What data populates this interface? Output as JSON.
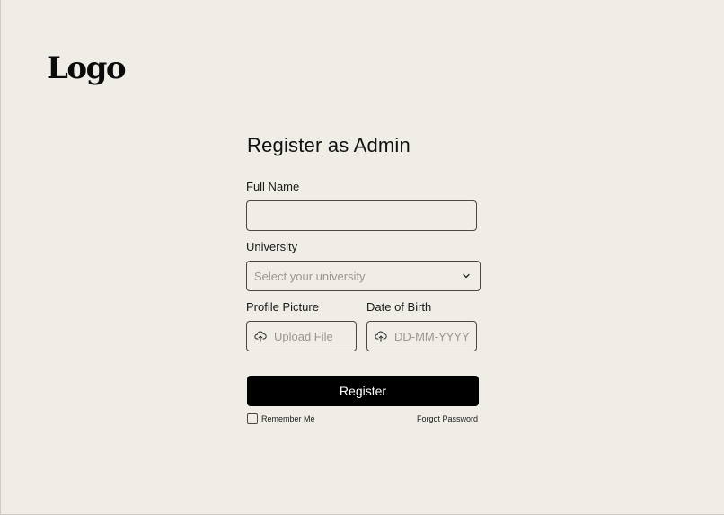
{
  "logo": {
    "text": "Logo"
  },
  "form": {
    "title": "Register as Admin",
    "full_name": {
      "label": "Full Name",
      "value": "",
      "placeholder": ""
    },
    "university": {
      "label": "University",
      "placeholder": "Select your university"
    },
    "profile_picture": {
      "label": "Profile Picture",
      "placeholder": "Upload File"
    },
    "date_of_birth": {
      "label": "Date of Birth",
      "placeholder": "DD-MM-YYYY"
    },
    "submit_label": "Register",
    "remember_label": "Remember Me",
    "forgot_label": "Forgot Password"
  },
  "icons": {
    "upload": "cloud-upload-icon",
    "chevron": "chevron-down-icon"
  },
  "colors": {
    "background": "#f0ece6",
    "button": "#000000",
    "button_text": "#ffffff",
    "border": "#4a4744",
    "placeholder": "#9a9792"
  }
}
